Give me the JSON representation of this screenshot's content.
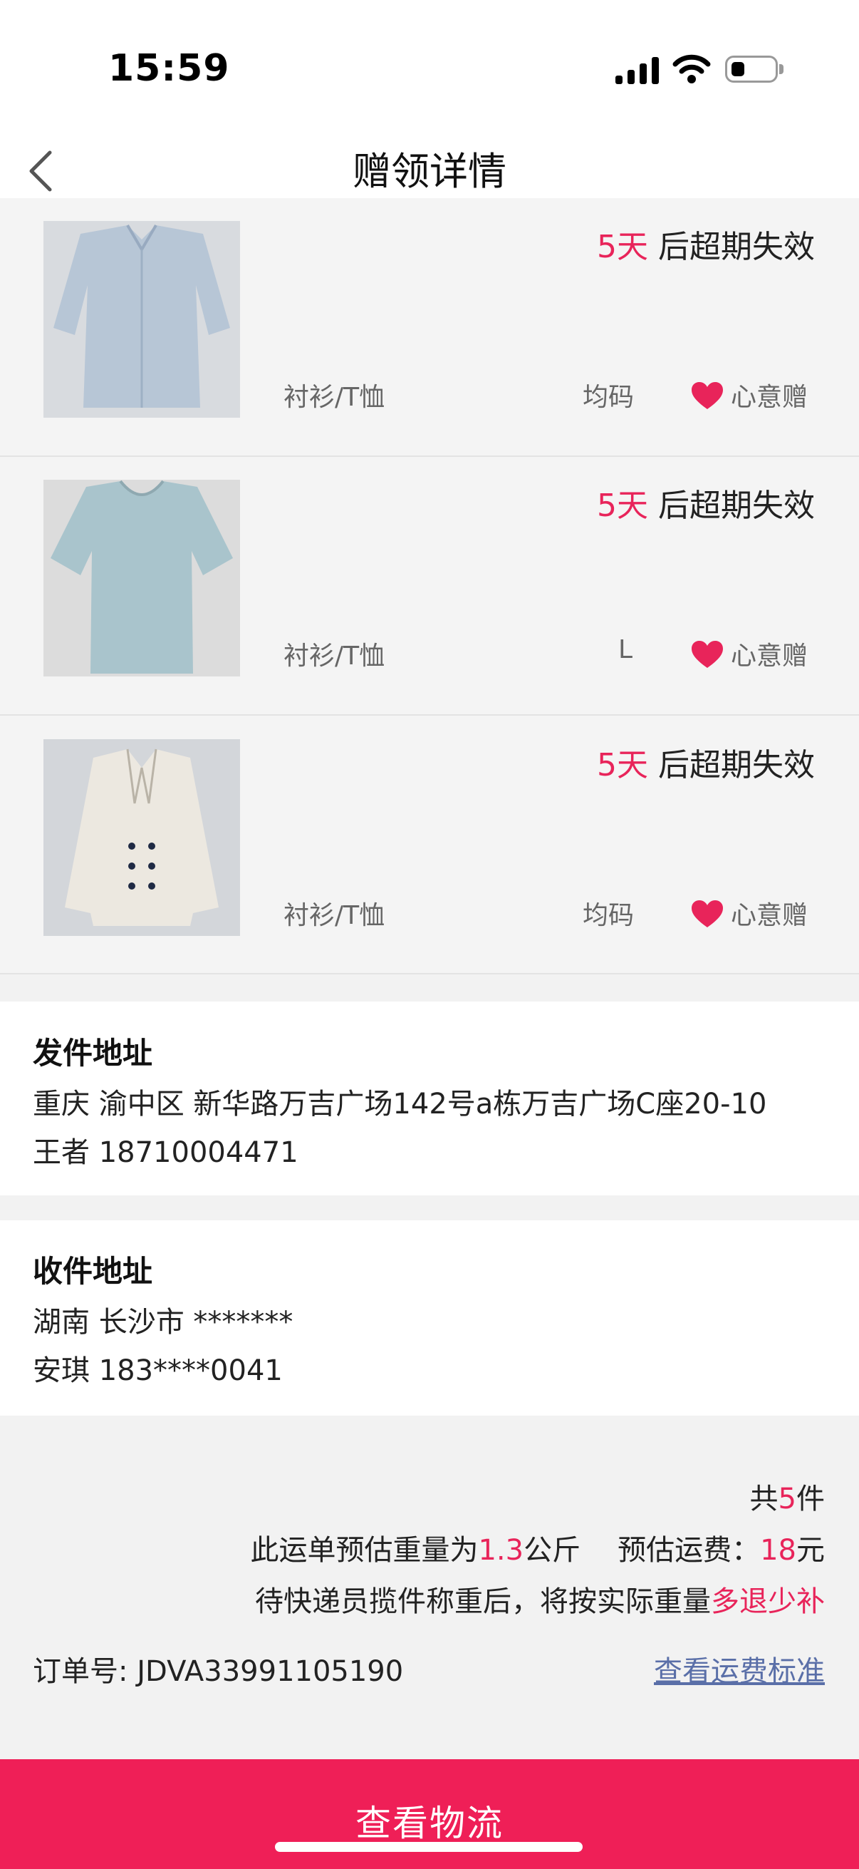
{
  "status_bar": {
    "time": "15:59"
  },
  "nav": {
    "title": "赠领详情"
  },
  "items": [
    {
      "days": "5天",
      "expire_suffix": " 后超期失效",
      "category": "衬衫/T恤",
      "size": "均码",
      "gift_type": "心意赠"
    },
    {
      "days": "5天",
      "expire_suffix": " 后超期失效",
      "category": "衬衫/T恤",
      "size": "L",
      "gift_type": "心意赠"
    },
    {
      "days": "5天",
      "expire_suffix": " 后超期失效",
      "category": "衬衫/T恤",
      "size": "均码",
      "gift_type": "心意赠"
    }
  ],
  "sender": {
    "title": "发件地址",
    "address": "重庆 渝中区 新华路万吉广场142号a栋万吉广场C座20-10",
    "contact": "王者 18710004471"
  },
  "receiver": {
    "title": "收件地址",
    "address": "湖南 长沙市 *******",
    "contact": "安琪 183****0041"
  },
  "summary": {
    "count_prefix": "共",
    "count": "5",
    "count_suffix": "件",
    "weight_prefix": "此运单预估重量为",
    "weight": "1.3",
    "weight_unit": "公斤",
    "fee_prefix": "预估运费：",
    "fee": "18",
    "fee_unit": "元",
    "note_prefix": "待快递员揽件称重后，将按实际重量",
    "note_highlight": "多退少补",
    "order_label": "订单号:",
    "order_no": "JDVA33991105190",
    "fee_link": "查看运费标准"
  },
  "bottom_button": {
    "label": "查看物流"
  },
  "colors": {
    "accent": "#ef1f57",
    "highlight": "#e8245a",
    "link": "#5a6fa8"
  },
  "icons": {
    "back": "chevron-left-icon",
    "heart": "heart-icon"
  }
}
